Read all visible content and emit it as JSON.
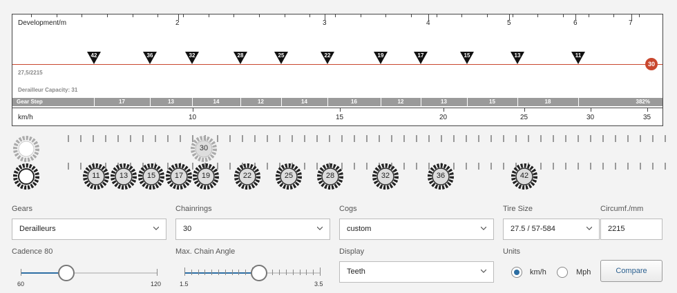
{
  "chart": {
    "development_label": "Development/m",
    "dev_ticks": [
      "2",
      "3",
      "4",
      "5",
      "6",
      "7"
    ],
    "cog_markers": [
      "42",
      "36",
      "32",
      "28",
      "25",
      "22",
      "19",
      "17",
      "15",
      "13",
      "11"
    ],
    "wheel_info": "27,5/2215",
    "derailleur_capacity": "Derailleur Capacity: 31",
    "chainring_marker": "30",
    "gear_step_label": "Gear Step",
    "gear_steps": [
      "17",
      "13",
      "14",
      "12",
      "14",
      "16",
      "12",
      "13",
      "15",
      "18"
    ],
    "gear_range": "382%",
    "kmh_label": "km/h",
    "speed_ticks": [
      "10",
      "15",
      "20",
      "25",
      "30",
      "35"
    ]
  },
  "cogs": {
    "chainring": "30",
    "values": [
      "11",
      "13",
      "15",
      "17",
      "19",
      "22",
      "25",
      "28",
      "32",
      "36",
      "42"
    ]
  },
  "form": {
    "gears_label": "Gears",
    "gears_value": "Derailleurs",
    "chainrings_label": "Chainrings",
    "chainrings_value": "30",
    "cogs_label": "Cogs",
    "cogs_value": "custom",
    "tire_label": "Tire Size",
    "tire_value": "27.5 / 57-584",
    "circumf_label": "Circumf./mm",
    "circumf_value": "2215",
    "cadence_label": "Cadence 80",
    "cadence_min": "60",
    "cadence_max": "120",
    "cadence_value": 80,
    "angle_label": "Max. Chain Angle",
    "angle_min": "1.5",
    "angle_max": "3.5",
    "angle_value": 2.5,
    "display_label": "Display",
    "display_value": "Teeth",
    "units_label": "Units",
    "unit_kmh": "km/h",
    "unit_mph": "Mph",
    "compare_label": "Compare"
  },
  "colors": {
    "accent": "#c9472e",
    "slider": "#2c6ea3"
  }
}
